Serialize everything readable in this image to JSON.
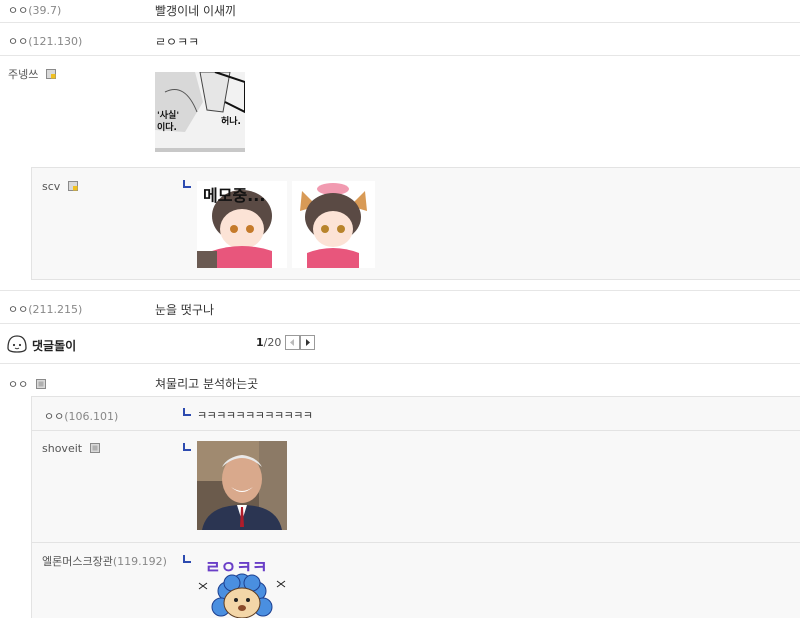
{
  "comments": [
    {
      "nick": "ㅇㅇ",
      "ip": "(39.7)",
      "text": "빨갱이네 이새끼"
    },
    {
      "nick": "ㅇㅇ",
      "ip": "(121.130)",
      "text": "ㄹㅇㅋㅋ"
    },
    {
      "nick": "주넹쓰",
      "image_text": [
        "'사실'",
        "이다.",
        "허나."
      ]
    },
    {
      "nick": "ㅇㅇ",
      "ip": "(211.215)",
      "text": "눈을 떳구나"
    }
  ],
  "reply_scv": {
    "nick": "scv",
    "sticker_text": "메모중..."
  },
  "dccon_bar": {
    "label": "댓글돌이",
    "page_current": "1",
    "page_total": "/20"
  },
  "thread2": {
    "main": {
      "nick": "ㅇㅇ",
      "text": "쳐물리고 분석하는곳"
    },
    "replies": [
      {
        "nick": "ㅇㅇ",
        "ip": "(106.101)",
        "text": "ㅋㅋㅋㅋㅋㅋㅋㅋㅋㅋㅋㅋ"
      },
      {
        "nick": "shoveit"
      },
      {
        "nick": "엘론머스크장관",
        "ip": "(119.192)",
        "sticker_text": "ㄹㅇㅋㅋ"
      }
    ]
  },
  "colors": {
    "reply_arrow": "#2d4bb0",
    "sticker_purple": "#6a3fc7",
    "sticker_blue": "#4a8fe0"
  }
}
